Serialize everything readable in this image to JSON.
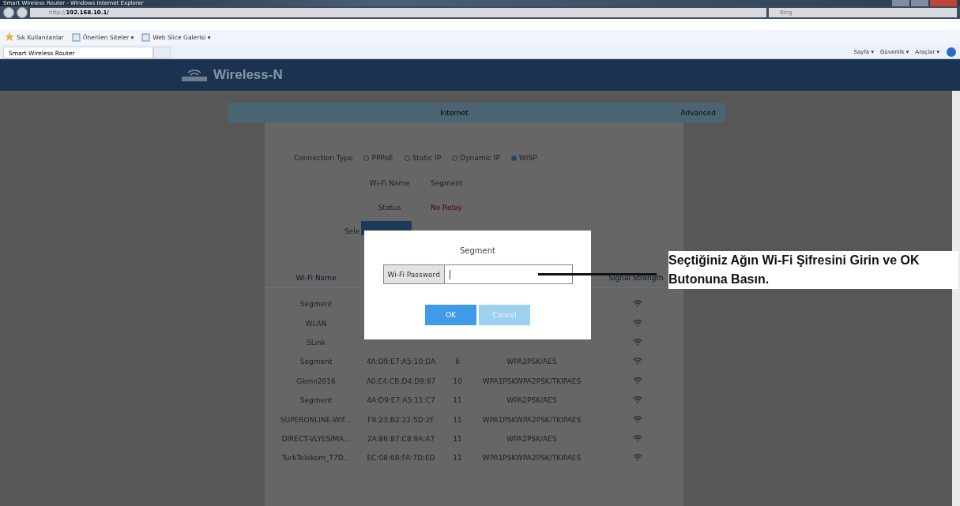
{
  "window": {
    "title": "Smart Wireless Router - Windows Internet Explorer"
  },
  "address_bar": {
    "url_prefix": "http://",
    "url_host": "192.168.10.1/",
    "search_placeholder": "Bing"
  },
  "favorites_bar": {
    "items": [
      {
        "label": "Sık Kullanılanlar",
        "kind": "star"
      },
      {
        "label": "Önerilen Siteler ▾",
        "kind": "page"
      },
      {
        "label": "Web Slice Galerisi ▾",
        "kind": "page"
      }
    ]
  },
  "tabs": [
    {
      "label": "Smart Wireless Router",
      "selected": true
    },
    {
      "selected": false
    }
  ],
  "command_bar": [
    "Sayfa ▾",
    "Güvenlik ▾",
    "Araçlar ▾"
  ],
  "header": {
    "logo_text": "Wireless-N"
  },
  "nav_tabs": [
    {
      "label": "Internet",
      "selected": true
    },
    {
      "label": "Advanced",
      "selected": false
    }
  ],
  "form": {
    "connection_type_label": "Connection Type",
    "connection_types": [
      {
        "label": "PPPoE",
        "selected": false
      },
      {
        "label": "Static IP",
        "selected": false
      },
      {
        "label": "Dynamic IP",
        "selected": false
      },
      {
        "label": "WISP",
        "selected": true
      }
    ],
    "wifi_name_label": "Wi-Fi Name",
    "wifi_name_value": "Segment",
    "status_label": "Status",
    "status_value": "No Relay",
    "select_label": "Sele"
  },
  "table": {
    "columns": [
      "Wi-Fi Name",
      "Signal Strength"
    ],
    "rows": [
      {
        "name": "Segment"
      },
      {
        "name": "WLAN"
      },
      {
        "name": "SLink"
      },
      {
        "name": "Segment",
        "bssid": "4A:D9:E7:A5:10:DA",
        "channel": "6",
        "security": "WPA2PSK/AES"
      },
      {
        "name": "Gkmn2016",
        "bssid": "A0:E4:CB:D4:D8:87",
        "channel": "10",
        "security": "WPA1PSKWPA2PSK/TKIPAES"
      },
      {
        "name": "Segment",
        "bssid": "4A:D9:E7:A5:11:C7",
        "channel": "11",
        "security": "WPA2PSK/AES"
      },
      {
        "name": "SUPERONLINE-WIF...",
        "bssid": "F8:23:B2:22:5D:2F",
        "channel": "11",
        "security": "WPA1PSKWPA2PSK/TKIPAES"
      },
      {
        "name": "DIRECT-VLYESIMA...",
        "bssid": "2A:86:87:C8:9A:A7",
        "channel": "11",
        "security": "WPA2PSK/AES"
      },
      {
        "name": "TurkTelekom_T7D...",
        "bssid": "EC:08:6B:FA:7D:ED",
        "channel": "11",
        "security": "WPA1PSKWPA2PSK/TKIPAES"
      }
    ]
  },
  "dialog": {
    "title": "Segment",
    "field_label": "Wi-Fi Password",
    "buttons": [
      {
        "label": "OK",
        "kind": "primary"
      },
      {
        "label": "Cancel",
        "kind": "secondary"
      }
    ]
  },
  "annotation": {
    "text": "Seçtiğiniz Ağın Wi-Fi Şifresini Girin ve OK Butonuna Basın."
  }
}
